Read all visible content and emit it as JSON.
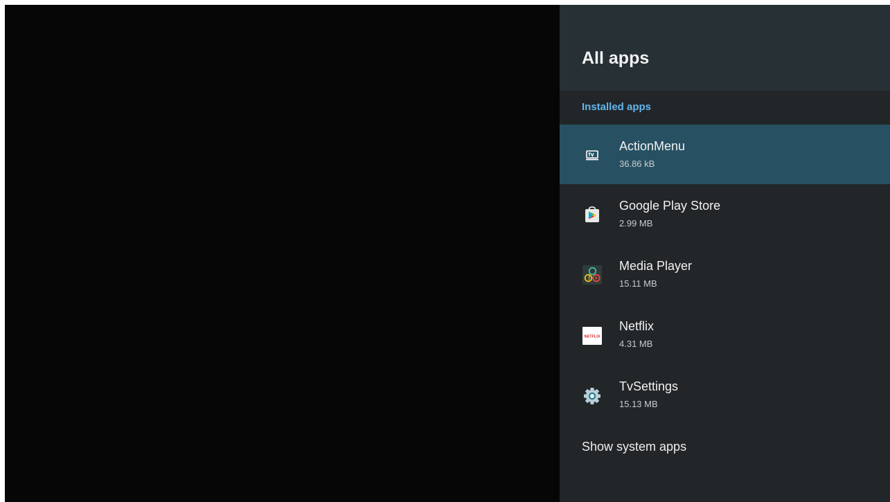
{
  "panel": {
    "title": "All apps",
    "section_title": "Installed apps",
    "apps": [
      {
        "name": "ActionMenu",
        "size": "36.86 kB",
        "icon": "tv-icon",
        "selected": true
      },
      {
        "name": "Google Play Store",
        "size": "2.99 MB",
        "icon": "play-store-icon",
        "selected": false
      },
      {
        "name": "Media Player",
        "size": "15.11 MB",
        "icon": "media-player-icon",
        "selected": false
      },
      {
        "name": "Netflix",
        "size": "4.31 MB",
        "icon": "netflix-icon",
        "icon_text": "NETFLIX",
        "selected": false
      },
      {
        "name": "TvSettings",
        "size": "15.13 MB",
        "icon": "gear-icon",
        "selected": false
      }
    ],
    "show_system_label": "Show system apps"
  },
  "colors": {
    "screen_background": "#060606",
    "panel_background": "#222629",
    "header_background": "#263035",
    "selected_row": "#275163",
    "section_accent": "#62b6ee"
  }
}
